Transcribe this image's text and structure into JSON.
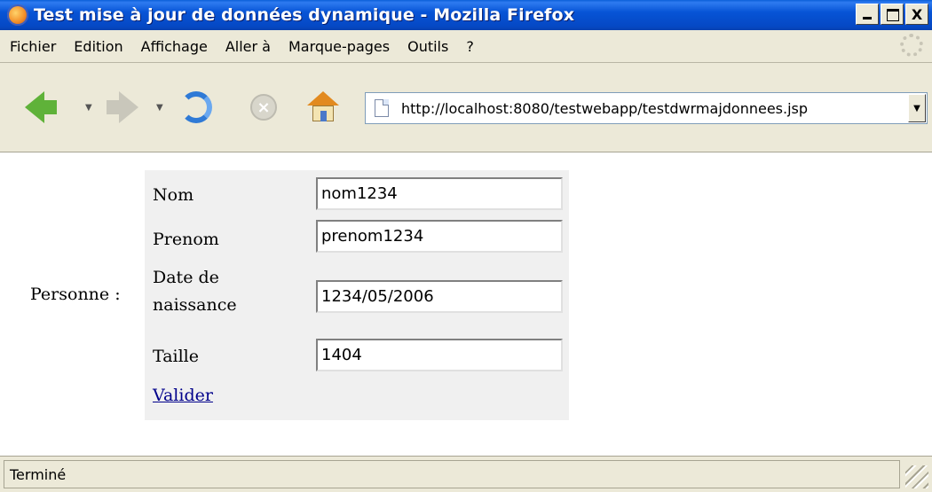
{
  "window": {
    "title": "Test mise à jour de données dynamique - Mozilla Firefox",
    "buttons": {
      "minimize": "_",
      "maximize": "□",
      "close": "X"
    }
  },
  "menu": [
    "Fichier",
    "Edition",
    "Affichage",
    "Aller à",
    "Marque-pages",
    "Outils",
    "?"
  ],
  "toolbar": {
    "url": "http://localhost:8080/testwebapp/testdwrmajdonnees.jsp",
    "icons": [
      "back-icon",
      "forward-icon",
      "reload-icon",
      "stop-icon",
      "home-icon",
      "page-icon"
    ]
  },
  "form": {
    "group_label": "Personne :",
    "fields": [
      {
        "label": "Nom",
        "value": "nom1234"
      },
      {
        "label": "Prenom",
        "value": "prenom1234"
      },
      {
        "label": "Date de naissance",
        "value": "1234/05/2006"
      },
      {
        "label": "Taille",
        "value": "1404"
      }
    ],
    "submit_label": "Valider"
  },
  "status": {
    "text": "Terminé"
  }
}
